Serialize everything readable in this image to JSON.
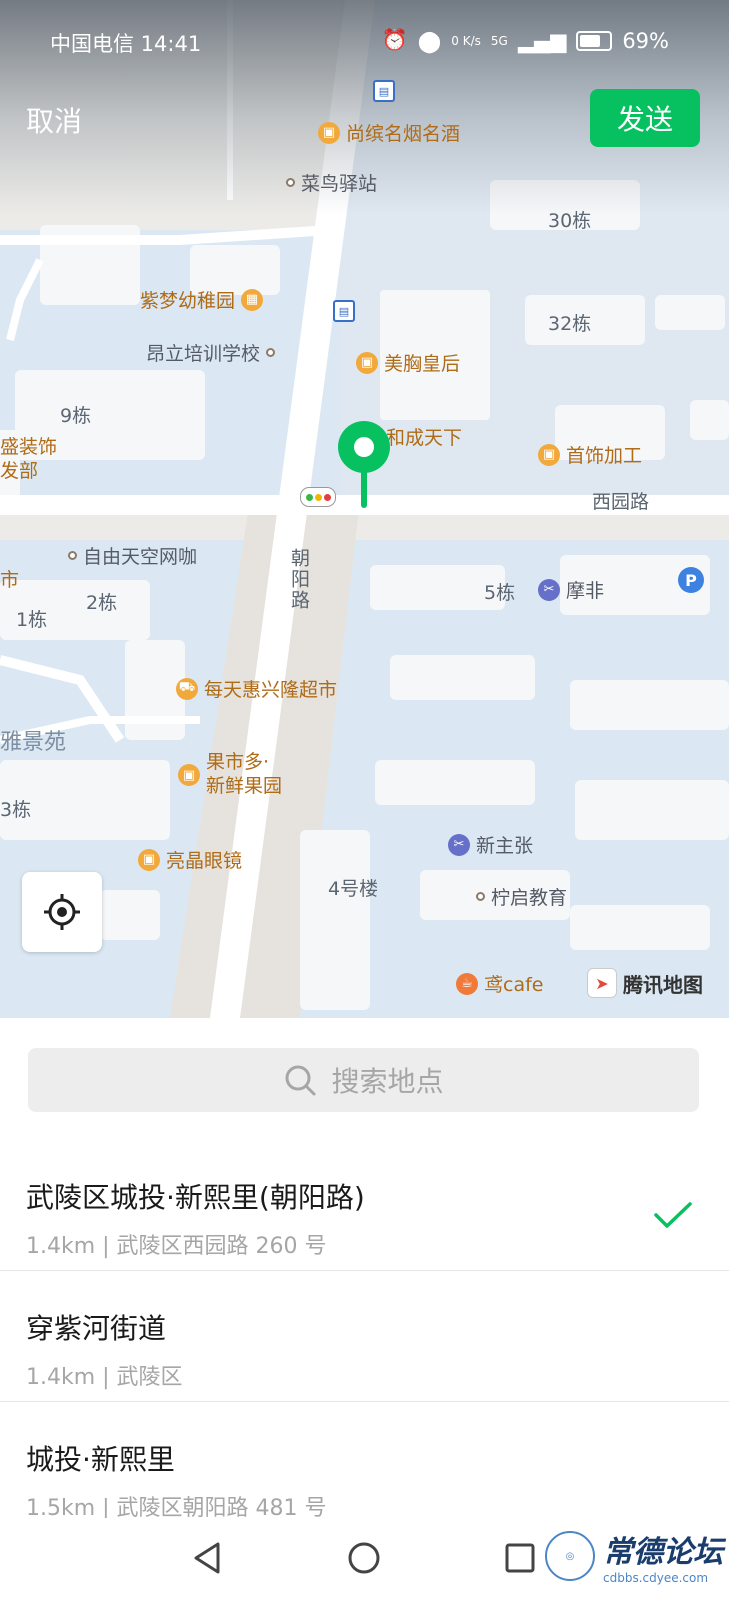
{
  "status_bar": {
    "carrier_time": "中国电信 14:41",
    "net_speed": "0 K/s",
    "signal": "5G",
    "battery": "69%"
  },
  "top_bar": {
    "cancel_label": "取消",
    "send_label": "发送"
  },
  "map": {
    "pois": [
      {
        "label": "尚缤名烟名酒"
      },
      {
        "label": "菜鸟驿站"
      },
      {
        "label": "紫梦幼稚园"
      },
      {
        "label": "昂立培训学校"
      },
      {
        "label": "美胸皇后"
      },
      {
        "label": "和成天下"
      },
      {
        "label": "首饰加工"
      },
      {
        "label": "盛装饰"
      },
      {
        "label": "发部"
      },
      {
        "label": "自由天空网咖"
      },
      {
        "label": "摩非"
      },
      {
        "label": "每天惠兴隆超市"
      },
      {
        "label": "雅景苑"
      },
      {
        "label": "果市多·"
      },
      {
        "label": "新鲜果园"
      },
      {
        "label": "亮晶眼镜"
      },
      {
        "label": "新主张"
      },
      {
        "label": "柠启教育"
      },
      {
        "label": "鸢cafe"
      },
      {
        "label": "市"
      }
    ],
    "buildings": [
      "30栋",
      "32栋",
      "9栋",
      "5栋",
      "2栋",
      "1栋",
      "3栋",
      "4号楼"
    ],
    "roads": [
      "西园路",
      "朝阳路"
    ],
    "parking_badge": "P",
    "provider": "腾讯地图"
  },
  "search": {
    "placeholder": "搜索地点"
  },
  "results": [
    {
      "name": "武陵区城投·新熙里(朝阳路)",
      "detail": "1.4km | 武陵区西园路 260 号",
      "selected": true
    },
    {
      "name": "穿紫河街道",
      "detail": "1.4km | 武陵区",
      "selected": false
    },
    {
      "name": "城投·新熙里",
      "detail": "1.5km | 武陵区朝阳路 481 号",
      "selected": false
    }
  ],
  "watermark": {
    "title": "常德论坛",
    "url": "cdbbs.cdyee.com"
  },
  "colors": {
    "accent_green": "#07c160",
    "map_water": "#dbe8f3",
    "road": "#ffffff"
  }
}
